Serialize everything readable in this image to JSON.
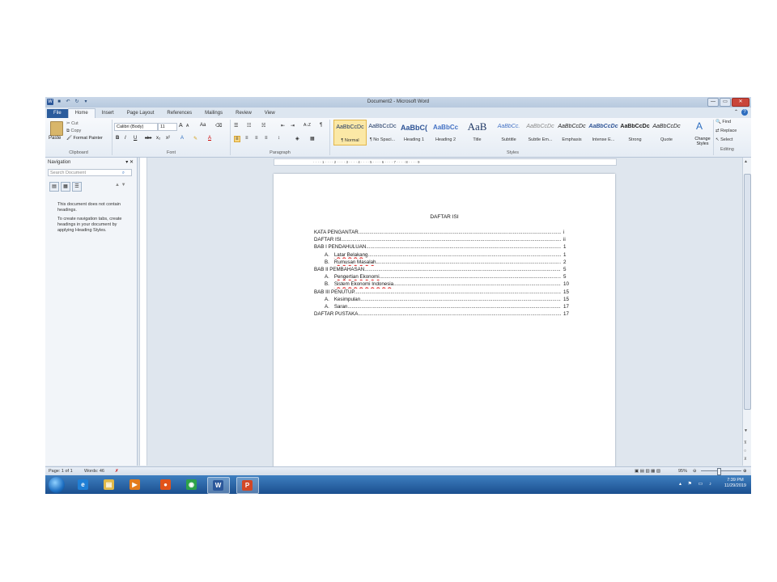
{
  "window": {
    "title": "Document2 - Microsoft Word",
    "controls": {
      "minimize": "—",
      "maximize": "▭",
      "close": "✕"
    }
  },
  "qat": {
    "word": "W",
    "save": "■",
    "undo": "↶",
    "redo": "↻",
    "more": "▾"
  },
  "tabs": [
    "File",
    "Home",
    "Insert",
    "Page Layout",
    "References",
    "Mailings",
    "Review",
    "View"
  ],
  "clipboard": {
    "paste": "Paste",
    "cut": "Cut",
    "copy": "Copy",
    "format_painter": "Format Painter",
    "label": "Clipboard"
  },
  "font": {
    "family": "Calibri (Body)",
    "size": "11",
    "grow": "A",
    "shrink": "A",
    "bold": "B",
    "italic": "I",
    "underline": "U",
    "strike": "abe",
    "sub": "x₂",
    "sup": "x²",
    "label": "Font"
  },
  "paragraph": {
    "label": "Paragraph",
    "pilcrow": "¶",
    "sort": "A↓Z"
  },
  "styles": {
    "label": "Styles",
    "items": [
      {
        "sample": "AaBbCcDc",
        "name": "¶ Normal"
      },
      {
        "sample": "AaBbCcDc",
        "name": "¶ No Spaci..."
      },
      {
        "sample": "AaBbC(",
        "name": "Heading 1"
      },
      {
        "sample": "AaBbCc",
        "name": "Heading 2"
      },
      {
        "sample": "AaB",
        "name": "Title"
      },
      {
        "sample": "AaBbCc.",
        "name": "Subtitle"
      },
      {
        "sample": "AaBbCcDc",
        "name": "Subtle Em..."
      },
      {
        "sample": "AaBbCcDc",
        "name": "Emphasis"
      },
      {
        "sample": "AaBbCcDc",
        "name": "Intense E..."
      },
      {
        "sample": "AaBbCcDc",
        "name": "Strong"
      },
      {
        "sample": "AaBbCcDc",
        "name": "Quote"
      }
    ],
    "change_styles": "Change Styles"
  },
  "editing": {
    "find": "Find",
    "replace": "Replace",
    "select": "Select",
    "label": "Editing"
  },
  "navigation": {
    "title": "Navigation",
    "search_placeholder": "Search Document",
    "msg1": "This document does not contain headings.",
    "msg2": "To create navigation tabs, create headings in your document by applying Heading Styles."
  },
  "document": {
    "title": "DAFTAR ISI",
    "toc": [
      {
        "text": "KATA PENGANTAR",
        "page": "i",
        "sub": false
      },
      {
        "text": "DAFTAR ISI",
        "page": "ii",
        "sub": false
      },
      {
        "text": "BAB I PENDAHULUAN",
        "page": "1",
        "sub": false
      },
      {
        "prefix": "A.",
        "text": "Latar Belakang",
        "page": "1",
        "sub": true
      },
      {
        "prefix": "B.",
        "text": "Rumusan Masalah",
        "page": "2",
        "sub": true
      },
      {
        "text": "BAB II PEMBAHASAN",
        "page": "5",
        "sub": false
      },
      {
        "prefix": "A.",
        "text": "Pengertian Ekonomi",
        "page": "5",
        "sub": true
      },
      {
        "prefix": "B.",
        "text": "Sistem Ekonomi Indonesia",
        "page": "10",
        "sub": true
      },
      {
        "text": "BAB III PENUTUP",
        "page": "15",
        "sub": false
      },
      {
        "prefix": "A.",
        "text": "Kesimpulan",
        "page": "15",
        "sub": true
      },
      {
        "prefix": "A.",
        "text": "Saran",
        "page": "17",
        "sub": true
      },
      {
        "text": "DAFTAR PUSTAKA",
        "page": "17",
        "sub": false
      }
    ]
  },
  "status": {
    "page": "Page: 1 of 1",
    "words": "Words: 46",
    "zoom": "95%"
  },
  "taskbar": {
    "time": "7:39 PM",
    "date": "11/29/2019",
    "apps": [
      {
        "name": "ie",
        "glyph": "e",
        "color": "#1f7fd6"
      },
      {
        "name": "explorer",
        "glyph": "▤",
        "color": "#e0b94a"
      },
      {
        "name": "media-player",
        "glyph": "▶",
        "color": "#e37b1c"
      },
      {
        "name": "firefox",
        "glyph": "●",
        "color": "#e2531a"
      },
      {
        "name": "chrome",
        "glyph": "◉",
        "color": "#2da24a"
      },
      {
        "name": "word",
        "glyph": "W",
        "color": "#2b579a"
      },
      {
        "name": "powerpoint",
        "glyph": "P",
        "color": "#d24726"
      }
    ]
  }
}
